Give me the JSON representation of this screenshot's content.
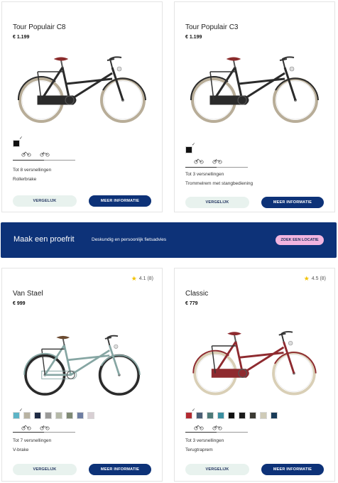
{
  "products": [
    {
      "id": "c8",
      "title": "Tour Populair C8",
      "price": "€ 1.199",
      "frame_color": "#2b2b2b",
      "accent": "#8a2b2b",
      "tire": "#b8ad98",
      "swatches": [
        "#111111"
      ],
      "frame_types": [
        "lady-frame-icon",
        "gent-frame-icon"
      ],
      "specs": [
        "Tot 8 versnellingen",
        "Rollerbrake"
      ],
      "compare_label": "VERGELIJK",
      "info_label": "MEER INFORMATIE"
    },
    {
      "id": "c3",
      "title": "Tour Populair C3",
      "price": "€ 1.199",
      "frame_color": "#2b2b2b",
      "accent": "#8a2b2b",
      "tire": "#b8ad98",
      "swatches": [
        "#111111"
      ],
      "frame_types": [
        "lady-frame-icon",
        "gent-frame-icon"
      ],
      "specs": [
        "Tot 3 versnellingen",
        "Trommelrem met stangbediening"
      ],
      "compare_label": "VERGELIJK",
      "info_label": "MEER INFORMATIE"
    },
    {
      "id": "vanstael",
      "title": "Van Stael",
      "price": "€ 999",
      "rating": "4.1 (8)",
      "frame_color": "#86a6a3",
      "accent": "#6b4a30",
      "tire": "#2a2a2a",
      "swatches": [
        "#5db4c6",
        "#b9b3a2",
        "#1f2b45",
        "#9a9a98",
        "#b5b9a8",
        "#7f8a74",
        "#6e7ea2",
        "#d8cfd3"
      ],
      "frame_types": [
        "lady-frame-icon",
        "gent-frame-icon"
      ],
      "specs": [
        "Tot 7 versnellingen",
        "V-brake"
      ],
      "compare_label": "VERGELIJK",
      "info_label": "MEER INFORMATIE"
    },
    {
      "id": "classic",
      "title": "Classic",
      "price": "€ 779",
      "rating": "4.5 (8)",
      "frame_color": "#8e2a2f",
      "accent": "#8e2a2f",
      "tire": "#d9cfb6",
      "swatches": [
        "#b22a31",
        "#4b5f75",
        "#4e7a78",
        "#3a8fa0",
        "#111111",
        "#1a1a1a",
        "#3b3a33",
        "#cfcbb8",
        "#193b58"
      ],
      "frame_types": [
        "lady-frame-icon",
        "gent-frame-icon"
      ],
      "specs": [
        "Tot 3 versnellingen",
        "Terugtraprem"
      ],
      "compare_label": "VERGELIJK",
      "info_label": "MEER INFORMATIE"
    }
  ],
  "banner": {
    "title": "Maak een proefrit",
    "subtitle": "Deskundig en persoonlijk fietsadvies",
    "button": "ZOEK EEN LOCATIE"
  },
  "colors": {
    "primary": "#0d3278",
    "compare_bg": "#e8f2ee",
    "banner_button": "#f2b5e0",
    "star": "#f2c200"
  }
}
